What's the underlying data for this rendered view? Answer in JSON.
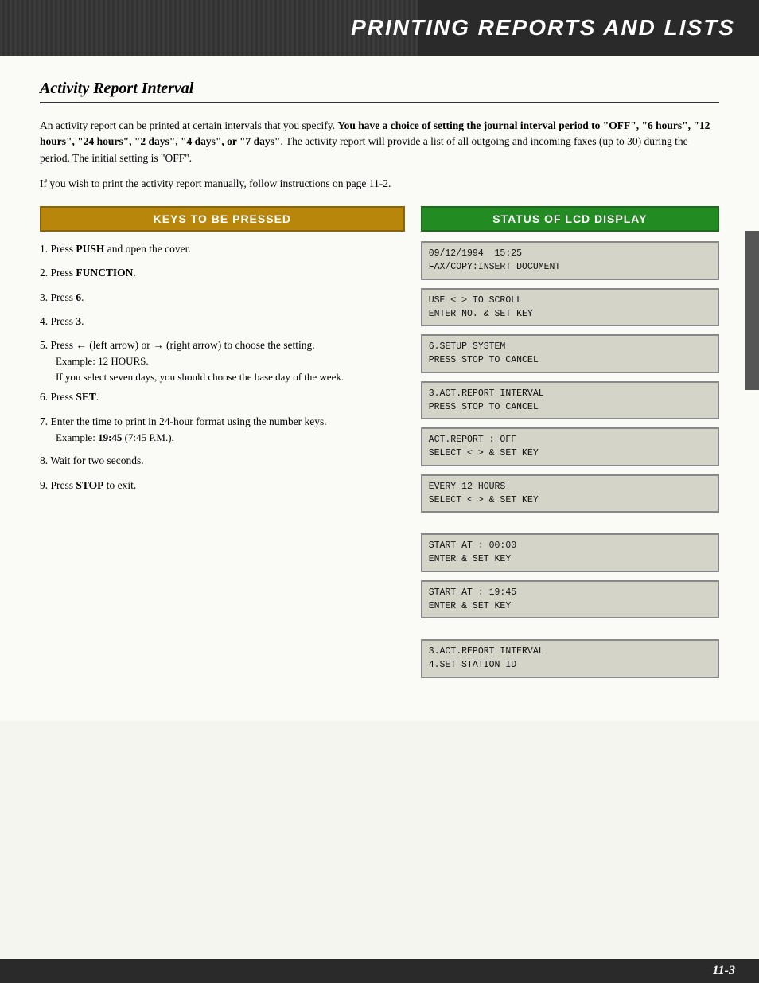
{
  "header": {
    "title": "PRINTING REPORTS AND LISTS"
  },
  "section": {
    "title": "Activity Report Interval"
  },
  "body_paragraphs": [
    "An activity report can be printed at certain intervals that you specify. You have a choice of setting the journal interval period to \"OFF\", \"6 hours\", \"12 hours\", \"24 hours\", \"2 days\", \"4 days\", or \"7 days\". The activity report will provide a list of all outgoing and incoming faxes (up to 30) during the period. The initial setting is \"OFF\".",
    "If you wish to print the activity report manually, follow instructions on page 11-2."
  ],
  "keys_header": "KEYS TO BE PRESSED",
  "status_header": "STATUS OF LCD DISPLAY",
  "steps": [
    {
      "num": "1.",
      "text": "Press ",
      "bold": "PUSH",
      "rest": " and open the cover."
    },
    {
      "num": "2.",
      "text": "Press ",
      "bold": "FUNCTION",
      "rest": "."
    },
    {
      "num": "3.",
      "text": "Press ",
      "bold": "6",
      "rest": "."
    },
    {
      "num": "4.",
      "text": "Press ",
      "bold": "3",
      "rest": "."
    },
    {
      "num": "5.",
      "text": "Press ← (left arrow) or → (right arrow) to choose the setting.",
      "sub": [
        "Example: 12 HOURS.",
        "If you select seven days, you should choose the base day of the week."
      ]
    },
    {
      "num": "6.",
      "text": "Press ",
      "bold": "SET",
      "rest": "."
    },
    {
      "num": "7.",
      "text": "Enter the time to print in 24-hour format using the number keys.",
      "sub": [
        "Example: 19:45 (7:45 P.M.)."
      ]
    },
    {
      "num": "8.",
      "text": "Wait for two seconds."
    },
    {
      "num": "9.",
      "text": "Press ",
      "bold": "STOP",
      "rest": " to exit."
    }
  ],
  "lcd_displays": [
    {
      "group": "step1",
      "lines": [
        "09/12/1994  15:25",
        "FAX/COPY:INSERT DOCUMENT"
      ]
    },
    {
      "group": "step2",
      "lines": [
        "USE < > TO SCROLL",
        "ENTER NO. & SET KEY"
      ]
    },
    {
      "group": "step3",
      "lines": [
        "6.SETUP SYSTEM",
        "PRESS STOP TO CANCEL"
      ]
    },
    {
      "group": "step4",
      "lines": [
        "3.ACT.REPORT INTERVAL",
        "PRESS STOP TO CANCEL"
      ]
    },
    {
      "group": "step4b",
      "lines": [
        "ACT.REPORT : OFF",
        "SELECT < > & SET KEY"
      ]
    },
    {
      "group": "step5",
      "lines": [
        "EVERY 12 HOURS",
        "SELECT < > & SET KEY"
      ]
    },
    {
      "group": "step6a",
      "lines": [
        "START AT : 00:00",
        "ENTER & SET KEY"
      ]
    },
    {
      "group": "step6b",
      "lines": [
        "START AT : 19:45",
        "ENTER & SET KEY"
      ]
    },
    {
      "group": "step9",
      "lines": [
        "3.ACT.REPORT INTERVAL",
        "4.SET STATION ID"
      ]
    }
  ],
  "footer": {
    "page": "11-3"
  }
}
